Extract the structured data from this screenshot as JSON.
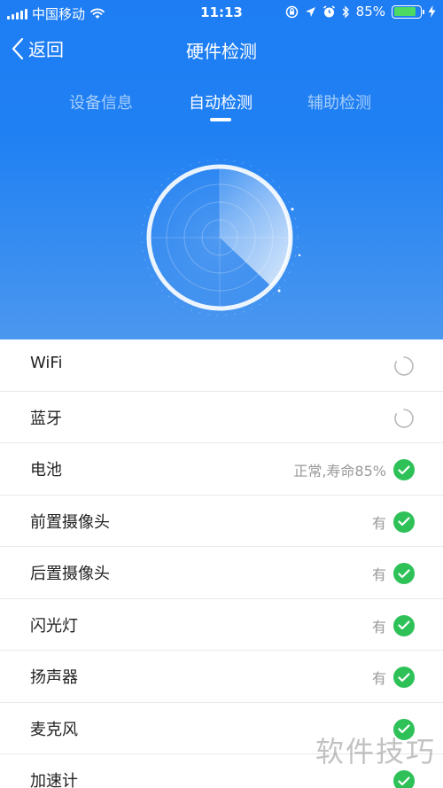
{
  "status_bar": {
    "carrier": "中国移动",
    "time": "11:13",
    "battery_percent": "85%",
    "battery_level": 0.85,
    "icons": [
      "wifi-icon",
      "orientation-lock-icon",
      "location-icon",
      "alarm-icon",
      "bluetooth-icon",
      "charging-icon"
    ]
  },
  "nav": {
    "back_label": "返回",
    "title": "硬件检测"
  },
  "tabs": [
    {
      "label": "设备信息",
      "active": false
    },
    {
      "label": "自动检测",
      "active": true
    },
    {
      "label": "辅助检测",
      "active": false
    }
  ],
  "items": [
    {
      "label": "WiFi",
      "value": "",
      "status": "loading"
    },
    {
      "label": "蓝牙",
      "value": "",
      "status": "loading"
    },
    {
      "label": "电池",
      "value": "正常,寿命85%",
      "status": "ok"
    },
    {
      "label": "前置摄像头",
      "value": "有",
      "status": "ok"
    },
    {
      "label": "后置摄像头",
      "value": "有",
      "status": "ok"
    },
    {
      "label": "闪光灯",
      "value": "有",
      "status": "ok"
    },
    {
      "label": "扬声器",
      "value": "有",
      "status": "ok"
    },
    {
      "label": "麦克风",
      "value": "",
      "status": "ok"
    },
    {
      "label": "加速计",
      "value": "",
      "status": "ok"
    }
  ],
  "watermark": "软件技巧",
  "colors": {
    "primary": "#1e7df3",
    "success": "#2ec158",
    "muted": "#999999"
  }
}
